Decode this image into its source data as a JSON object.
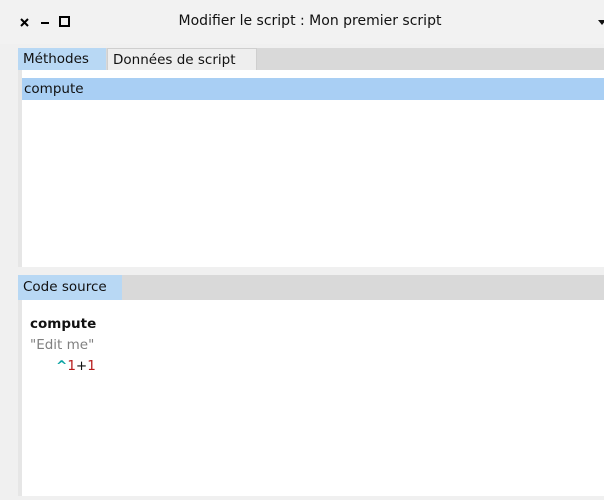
{
  "window": {
    "title": "Modifier le script : Mon premier script",
    "controls": {
      "close": "close-icon",
      "minimize": "minimize-icon",
      "maximize": "maximize-icon",
      "menu": "menu-arrow-icon"
    }
  },
  "top_tabs": {
    "items": [
      {
        "label": "Méthodes",
        "active": true
      },
      {
        "label": "Données de script",
        "active": false
      }
    ]
  },
  "methods": {
    "items": [
      {
        "label": "compute",
        "selected": true
      }
    ]
  },
  "bottom_tabs": {
    "items": [
      {
        "label": "Code source",
        "active": true
      }
    ]
  },
  "source": {
    "selector": "compute",
    "comment": "\"Edit me\"",
    "caret": "^",
    "left": "1",
    "op": "+",
    "right": "1"
  },
  "colors": {
    "tab_active": "#b8d8f4",
    "selection": "#a9cff4",
    "caret": "#0aa3a3",
    "number": "#b71c1c",
    "comment": "#808080"
  }
}
